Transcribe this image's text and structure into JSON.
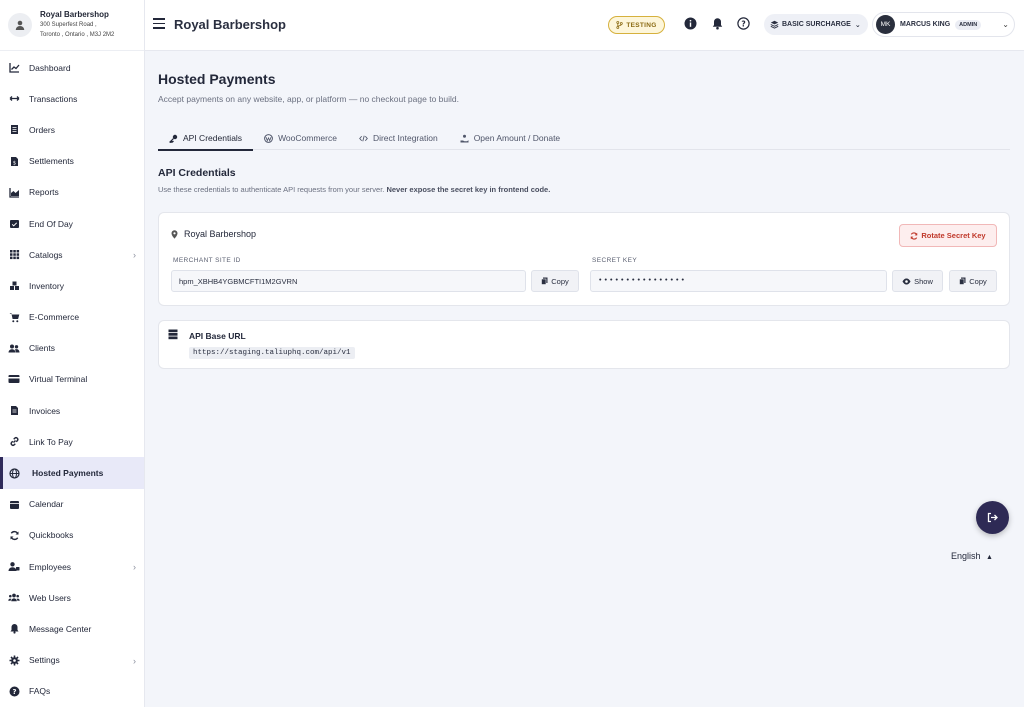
{
  "brand": {
    "name": "Royal Barbershop",
    "address_line1": "300 Superfest Road ,",
    "address_line2": "Toronto , Ontario , M3J 2M2"
  },
  "sidebar": {
    "items": [
      {
        "label": "Dashboard",
        "icon": "chart-line-icon"
      },
      {
        "label": "Transactions",
        "icon": "arrows-horizontal-icon"
      },
      {
        "label": "Orders",
        "icon": "receipt-icon"
      },
      {
        "label": "Settlements",
        "icon": "document-dollar-icon"
      },
      {
        "label": "Reports",
        "icon": "chart-area-icon"
      },
      {
        "label": "End Of Day",
        "icon": "calendar-check-icon"
      },
      {
        "label": "Catalogs",
        "icon": "grid-icon"
      },
      {
        "label": "Inventory",
        "icon": "boxes-icon"
      },
      {
        "label": "E-Commerce",
        "icon": "cart-icon"
      },
      {
        "label": "Clients",
        "icon": "users-icon"
      },
      {
        "label": "Virtual Terminal",
        "icon": "credit-card-icon"
      },
      {
        "label": "Invoices",
        "icon": "invoice-icon"
      },
      {
        "label": "Link To Pay",
        "icon": "link-icon"
      },
      {
        "label": "Hosted Payments",
        "icon": "globe-icon"
      },
      {
        "label": "Calendar",
        "icon": "calendar-icon"
      },
      {
        "label": "Quickbooks",
        "icon": "sync-icon"
      },
      {
        "label": "Employees",
        "icon": "user-tie-icon"
      },
      {
        "label": "Web Users",
        "icon": "user-group-icon"
      },
      {
        "label": "Message Center",
        "icon": "bell-icon"
      },
      {
        "label": "Settings",
        "icon": "gear-icon"
      },
      {
        "label": "FAQs",
        "icon": "question-circle-icon"
      }
    ]
  },
  "header": {
    "title": "Royal Barbershop",
    "testing_label": "TESTING",
    "surcharge_label": "BASIC SURCHARGE",
    "user_initials": "MK",
    "user_name": "MARCUS KING",
    "user_role": "ADMIN"
  },
  "page": {
    "title": "Hosted Payments",
    "subtitle": "Accept payments on any website, app, or platform — no checkout page to build.",
    "tabs": [
      {
        "label": "API Credentials",
        "icon": "key-icon"
      },
      {
        "label": "WooCommerce",
        "icon": "wordpress-icon"
      },
      {
        "label": "Direct Integration",
        "icon": "code-icon"
      },
      {
        "label": "Open Amount / Donate",
        "icon": "hand-donate-icon"
      }
    ],
    "section_title": "API Credentials",
    "section_desc": "Use these credentials to authenticate API requests from your server.",
    "section_warning": "Never expose the secret key in frontend code."
  },
  "credentials": {
    "location_name": "Royal Barbershop",
    "rotate_label": "Rotate Secret Key",
    "merchant_label": "MERCHANT SITE ID",
    "merchant_value": "hpm_XBHB4YGBMCFTI1M2GVRN",
    "secret_label": "SECRET KEY",
    "secret_value": "••••••••••••••••",
    "copy_label": "Copy",
    "show_label": "Show"
  },
  "api": {
    "title": "API Base URL",
    "url": "https://staging.taliuphq.com/api/v1"
  },
  "footer": {
    "language": "English"
  },
  "colors": {
    "accent": "#2e2a55",
    "danger": "#c0392b",
    "testing": "#d6b13d"
  }
}
